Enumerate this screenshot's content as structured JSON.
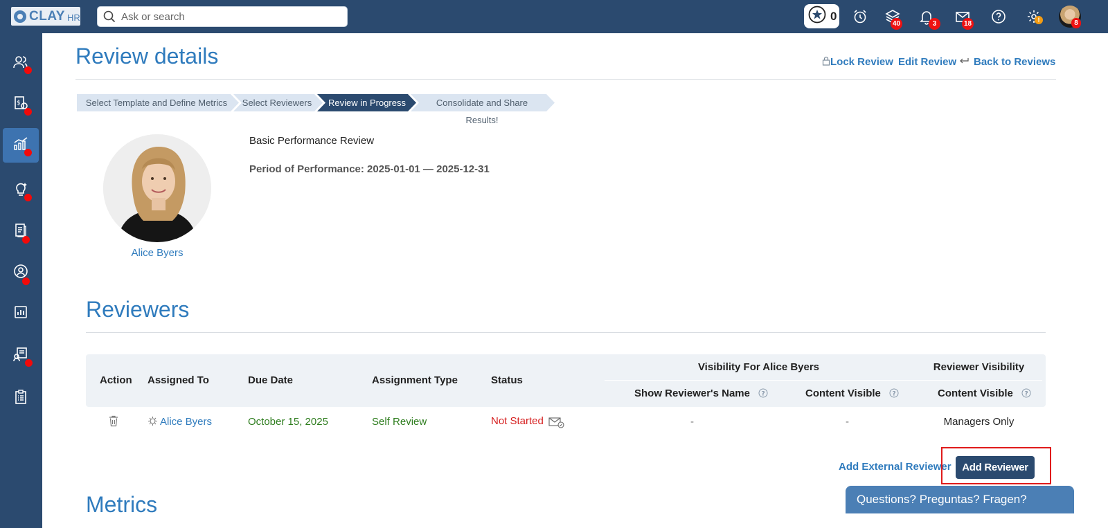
{
  "topbar": {
    "logo_text": "CLAY",
    "logo_sub": "HR",
    "search_placeholder": "Ask or search",
    "stars_count": "0",
    "badges": {
      "layers": "40",
      "bell": "3",
      "mail": "18",
      "avatar": "8"
    },
    "icons": [
      "star-icon",
      "alarm-clock-icon",
      "layers-icon",
      "bell-icon",
      "mail-icon",
      "help-icon",
      "gear-icon",
      "avatar"
    ]
  },
  "sidebar": {
    "items": [
      {
        "icon": "people-icon"
      },
      {
        "icon": "payroll-icon"
      },
      {
        "icon": "performance-chart-icon",
        "active": true
      },
      {
        "icon": "lightbulb-icon"
      },
      {
        "icon": "documents-icon"
      },
      {
        "icon": "user-circle-icon"
      },
      {
        "icon": "reports-icon"
      },
      {
        "icon": "training-icon"
      },
      {
        "icon": "checklist-icon"
      }
    ]
  },
  "page": {
    "title": "Review details",
    "actions": {
      "lock": "Lock Review",
      "edit": "Edit Review",
      "back": "Back to Reviews"
    }
  },
  "steps": [
    "Select Template and Define Metrics",
    "Select Reviewers",
    "Review in Progress",
    "Consolidate and Share Results!"
  ],
  "review": {
    "employee_name": "Alice Byers",
    "template_name": "Basic Performance Review",
    "period": "Period of Performance: 2025-01-01 — 2025-12-31"
  },
  "reviewers": {
    "title": "Reviewers",
    "headers": {
      "action": "Action",
      "assigned_to": "Assigned To",
      "due_date": "Due Date",
      "assignment_type": "Assignment Type",
      "status": "Status",
      "visibility_group": "Visibility For Alice Byers",
      "show_name": "Show Reviewer's Name",
      "content_visible": "Content Visible",
      "reviewer_visibility": "Reviewer Visibility",
      "reviewer_content_visible": "Content Visible"
    },
    "rows": [
      {
        "assigned_to": "Alice Byers",
        "due_date": "October 15, 2025",
        "assignment_type": "Self Review",
        "status": "Not Started",
        "show_name": "-",
        "content_visible": "-",
        "reviewer_content_visible": "Managers Only"
      }
    ],
    "add_external": "Add External Reviewer",
    "add_reviewer": "Add Reviewer"
  },
  "metrics": {
    "title": "Metrics"
  },
  "chat": {
    "label": "Questions? Preguntas? Fragen?"
  },
  "colors": {
    "nav": "#2b4a6f",
    "accent": "#2f7bbd",
    "due_date": "#2e7d1e",
    "status_not_started": "#d62020",
    "badge": "#e11111"
  }
}
